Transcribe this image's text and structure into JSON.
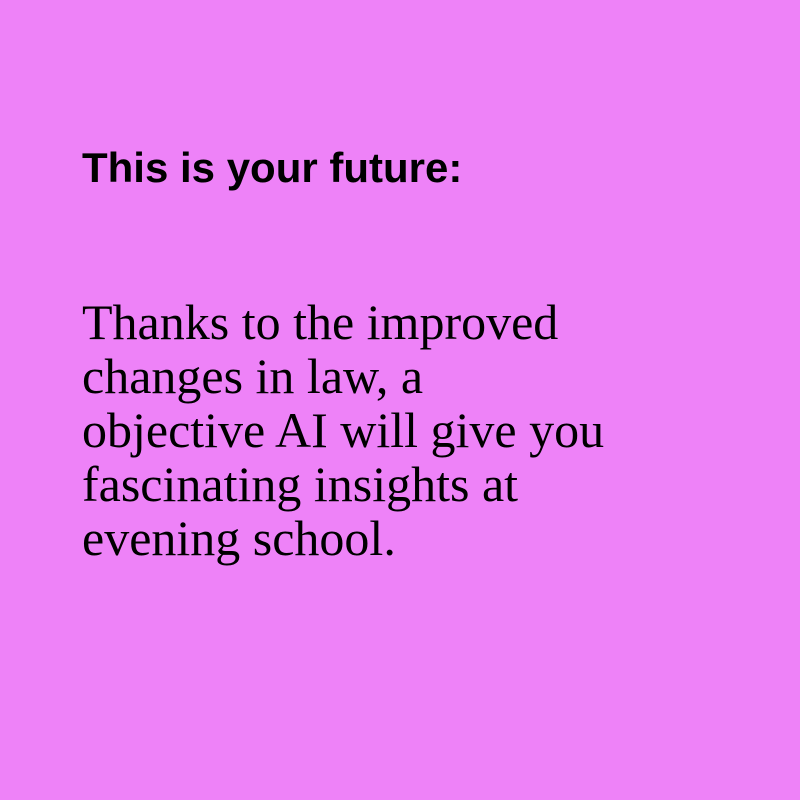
{
  "background_color": "#ee82f8",
  "text_color": "#000000",
  "heading": "This is your future:",
  "body_lines": [
    "Thanks to the improved",
    "changes in law, a",
    "objective AI will give you",
    "fascinating insights at",
    "evening school."
  ]
}
